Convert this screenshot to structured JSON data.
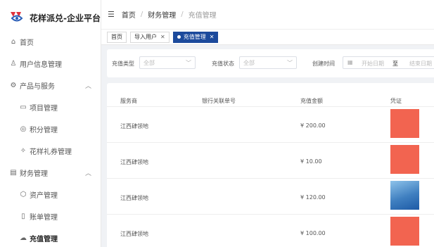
{
  "app": {
    "title": "花样派兑-企业平台"
  },
  "sidebar": {
    "items": [
      {
        "label": "首页",
        "icon": "home-icon"
      },
      {
        "label": "用户信息管理",
        "icon": "user-icon"
      },
      {
        "label": "产品与服务",
        "icon": "gear-icon",
        "expanded": true
      },
      {
        "label": "项目管理",
        "icon": "folder-icon"
      },
      {
        "label": "积分管理",
        "icon": "coin-icon"
      },
      {
        "label": "花样礼券管理",
        "icon": "ticket-icon"
      },
      {
        "label": "财务管理",
        "icon": "finance-icon",
        "expanded": true
      },
      {
        "label": "资产管理",
        "icon": "asset-icon"
      },
      {
        "label": "账单管理",
        "icon": "bill-icon"
      },
      {
        "label": "充值管理",
        "icon": "recharge-icon",
        "active": true
      }
    ]
  },
  "header": {
    "breadcrumb": [
      "首页",
      "财务管理",
      "充值管理"
    ]
  },
  "tabs": [
    {
      "label": "首页",
      "closable": false
    },
    {
      "label": "导入用户",
      "closable": true
    },
    {
      "label": "充值管理",
      "closable": true,
      "active": true
    }
  ],
  "filters": {
    "type_label": "充值类型",
    "type_value": "全部",
    "status_label": "充值状态",
    "status_value": "全部",
    "time_label": "创建时间",
    "start_placeholder": "开始日期",
    "range_sep": "至",
    "end_placeholder": "结束日期"
  },
  "table": {
    "columns": [
      "服务商",
      "银行关联单号",
      "充值金额",
      "凭证"
    ],
    "rows": [
      {
        "provider": "江西肆领地",
        "bank_ref": "",
        "amount": "¥ 200.00",
        "voucher": "red"
      },
      {
        "provider": "江西肆领地",
        "bank_ref": "",
        "amount": "¥ 10.00",
        "voucher": "red"
      },
      {
        "provider": "江西肆领地",
        "bank_ref": "",
        "amount": "¥ 120.00",
        "voucher": "blue"
      },
      {
        "provider": "江西肆领地",
        "bank_ref": "",
        "amount": "¥ 100.00",
        "voucher": "red"
      }
    ]
  },
  "colors": {
    "accent": "#1c4a9c",
    "voucher_red": "#f26450",
    "logo": "#e0323c"
  }
}
